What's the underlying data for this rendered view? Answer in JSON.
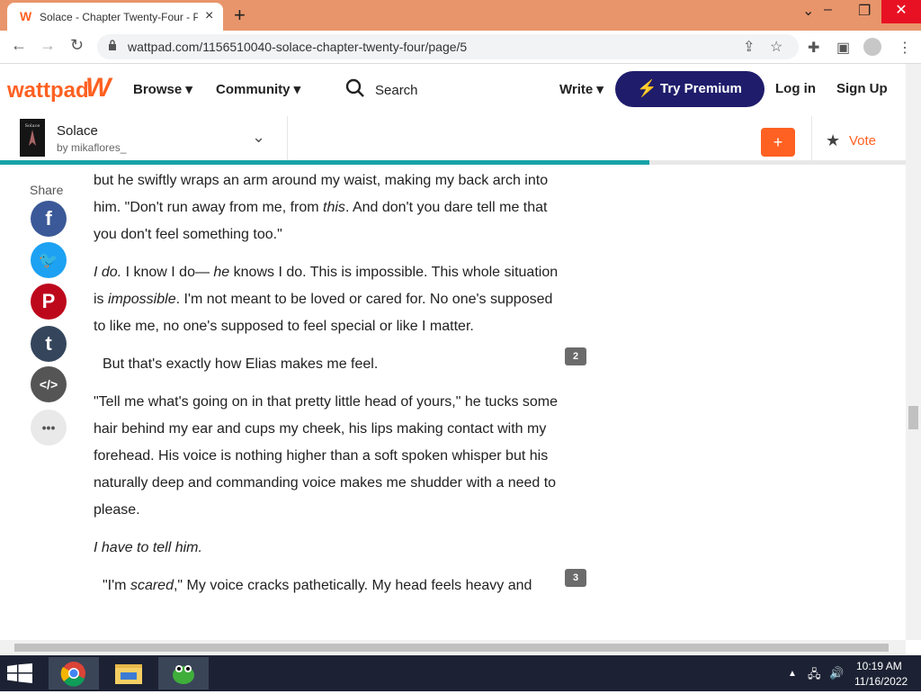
{
  "browser": {
    "tab_title": "Solace - Chapter Twenty-Four - P",
    "tab_close": "×",
    "new_tab": "+",
    "url": "wattpad.com/1156510040-solace-chapter-twenty-four/page/5",
    "window_controls": {
      "minimize": "⌄",
      "restore": "–",
      "maximize": "❐",
      "close": "✕"
    }
  },
  "header": {
    "logo_text": "wattpad",
    "nav": [
      {
        "label": "Browse ▾"
      },
      {
        "label": "Community ▾"
      }
    ],
    "search_label": "Search",
    "write_label": "Write ▾",
    "premium_label": "Try Premium",
    "login_label": "Log in",
    "signup_label": "Sign Up"
  },
  "story": {
    "title": "Solace",
    "author": "by mikaflores_",
    "add_label": "+",
    "vote_label": "Vote",
    "reading_progress": 0.705
  },
  "share": {
    "label": "Share",
    "buttons": [
      {
        "name": "facebook",
        "glyph": "f",
        "color": "#3b5998"
      },
      {
        "name": "twitter",
        "glyph": "🐦",
        "color": "#1da1f2"
      },
      {
        "name": "pinterest",
        "glyph": "P",
        "color": "#bd081c"
      },
      {
        "name": "tumblr",
        "glyph": "t",
        "color": "#35465c"
      },
      {
        "name": "embed",
        "glyph": "</>",
        "color": "#555555"
      },
      {
        "name": "more",
        "glyph": "•••",
        "color": "#e9e9e9"
      }
    ]
  },
  "content": {
    "paragraphs": [
      {
        "html": "but he swiftly wraps an arm around my waist, making my back arch into him. \"Don't run away from me, from <i>this</i>. And don't you dare tell me that you don't feel something too.\"",
        "indent": false
      },
      {
        "html": "<i>I do.</i> I know I do— <i>he</i> knows I do. This is impossible. This whole situation is <i>impossible</i>. I'm not meant to be loved or cared for. No one's supposed to like me, no one's supposed to feel special or like I matter.",
        "indent": false
      },
      {
        "html": "But that's exactly how Elias makes me feel.",
        "indent": true
      },
      {
        "html": "\"Tell me what's going on in that pretty little head of yours,\" he tucks some hair behind my ear and cups my cheek, his lips making contact with my forehead. His voice is nothing higher than a soft spoken whisper but his naturally deep and commanding voice makes me shudder with a need to please.",
        "indent": false
      },
      {
        "html": "<i>I have to tell him.</i>",
        "indent": false
      },
      {
        "html": "\"I'm <i>scared</i>,\" My voice cracks pathetically. My head feels heavy and",
        "indent": true
      }
    ],
    "comment_badges": [
      {
        "count": "2"
      },
      {
        "count": "3"
      }
    ]
  },
  "taskbar": {
    "time": "10:19 AM",
    "date": "11/16/2022"
  }
}
